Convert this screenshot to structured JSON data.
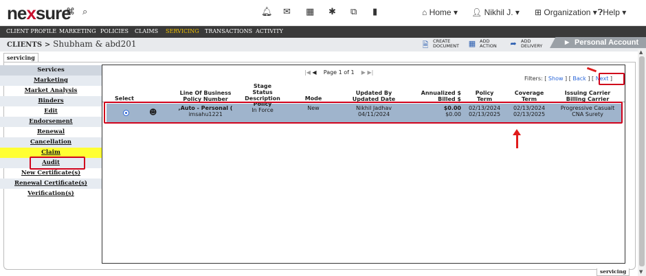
{
  "app": {
    "logo_pre": "ne",
    "logo_x": "x",
    "logo_post": "sure"
  },
  "topnav": {
    "home": "Home ▾",
    "user": "Nikhil J. ▾",
    "organization": "Organization ▾",
    "help": "Help ▾"
  },
  "menu": [
    "CLIENT PROFILE",
    "MARKETING",
    "POLICIES",
    "CLAIMS",
    "SERVICING",
    "TRANSACTIONS",
    "ACTIVITY"
  ],
  "menu_active": "SERVICING",
  "breadcrumb": {
    "clients": "CLIENTS",
    "sep": ">",
    "client": "Shubham & abd201"
  },
  "toolbar": {
    "create_document": [
      "CREATE",
      "DOCUMENT"
    ],
    "add_action": [
      "ADD",
      "ACTION"
    ],
    "add_delivery": [
      "ADD",
      "DELIVERY"
    ],
    "account_label": "Personal Account"
  },
  "tab_label": "servicing",
  "bottom_tab_label": "servicing",
  "services": {
    "header": "Services",
    "items": [
      "Marketing",
      "Market Analysis",
      "Binders",
      "Edit",
      "Endorsement",
      "Renewal",
      "Cancellation",
      "Claim",
      "Audit",
      "New Certificate(s)",
      "Renewal Certificate(s)",
      "Verification(s)"
    ],
    "highlighted": "Claim"
  },
  "pager": {
    "text": "Page 1 of 1"
  },
  "filters": {
    "label": "Filters:",
    "show": "Show",
    "back": "Back",
    "next": "Next"
  },
  "table": {
    "headers": {
      "select": "Select",
      "lob": [
        "Line Of Business",
        "Policy Number"
      ],
      "stage": [
        "Stage",
        "Status",
        "Description"
      ],
      "mode": "Mode",
      "updated": [
        "Updated By",
        "Updated Date"
      ],
      "annualized": [
        "Annualized $",
        "Billed $"
      ],
      "policy_term": [
        "Policy",
        "Term"
      ],
      "coverage_term": [
        "Coverage",
        "Term"
      ],
      "carrier": [
        "Issuing Carrier",
        "Billing Carrier"
      ]
    },
    "row": {
      "lob": ",Auto - Personal (",
      "policy_number": "imsahu1221",
      "stage": "Policy",
      "status": "In Force",
      "mode": "New",
      "updated_by": "Nikhil Jadhav",
      "updated_date": "04/11/2024",
      "annualized": "$0.00",
      "billed": "$0.00",
      "policy_term_from": "02/13/2024",
      "policy_term_to": "02/13/2025",
      "coverage_term_from": "02/13/2024",
      "coverage_term_to": "02/13/2025",
      "issuing_carrier": "Progressive Casualt",
      "billing_carrier": "CNA Surety"
    }
  },
  "colors": {
    "accent_red": "#d0021b",
    "menu_active": "#f2c200",
    "row_selected": "#9fb4cc",
    "link": "#2a66d9"
  }
}
